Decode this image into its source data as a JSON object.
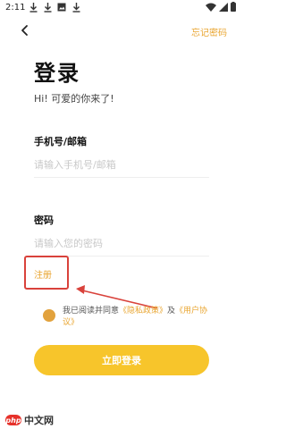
{
  "status_bar": {
    "time": "2:11",
    "notification_icons": [
      "download-icon",
      "download-icon",
      "photo-icon",
      "download-icon"
    ]
  },
  "header": {
    "forgot_password": "忘记密码"
  },
  "title": "登录",
  "subtitle": "Hi! 可爱的你来了!",
  "form": {
    "account_label": "手机号/邮箱",
    "account_placeholder": "请输入手机号/邮箱",
    "password_label": "密码",
    "password_placeholder": "请输入您的密码"
  },
  "register_label": "注册",
  "agreement": {
    "prefix": "我已阅读并同意",
    "privacy_link": "《隐私政策》",
    "conjunction": "及",
    "user_agreement_link": "《用户协议》",
    "checkbox_color": "#e2a23d"
  },
  "login_button": "立即登录",
  "colors": {
    "accent": "#e9a530",
    "button": "#f7c52b",
    "annotation": "#d9423b"
  },
  "watermark": {
    "badge": "php",
    "text": "中文网"
  }
}
